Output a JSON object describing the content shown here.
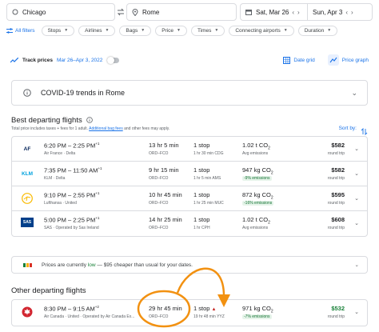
{
  "search": {
    "origin": "Chicago",
    "destination": "Rome",
    "depart_date": "Sat, Mar 26",
    "return_date": "Sun, Apr 3"
  },
  "filters": {
    "all_filters": "All filters",
    "chips": [
      "Stops",
      "Airlines",
      "Bags",
      "Price",
      "Times",
      "Connecting airports",
      "Duration"
    ]
  },
  "tracker": {
    "label": "Track prices",
    "range": "Mar 26–Apr 3, 2022",
    "date_grid": "Date grid",
    "price_graph": "Price graph"
  },
  "covid": {
    "label": "COVID-19 trends in Rome"
  },
  "best": {
    "title": "Best departing flights",
    "note_prefix": "Total price includes taxes + fees for 1 adult.",
    "note_link": "Additional bag fees",
    "note_suffix": "and other fees may apply.",
    "sort_label": "Sort by:",
    "flights": [
      {
        "logo": "AF",
        "logo_color": "#002157",
        "time": "6:20 PM – 2:25 PM",
        "plus": "+1",
        "airline": "Air France · Delta",
        "duration": "13 hr 5 min",
        "route": "ORD–FCO",
        "stops": "1 stop",
        "stop_detail": "1 hr 30 min CDG",
        "co2": "1.02 t CO",
        "co2_sub": "2",
        "emissions": "Avg emissions",
        "emissions_good": false,
        "price": "$582",
        "price_type": "round trip"
      },
      {
        "logo": "KLM",
        "logo_color": "#00a1de",
        "time": "7:35 PM – 11:50 AM",
        "plus": "+1",
        "airline": "KLM · Delta",
        "duration": "9 hr 15 min",
        "route": "ORD–FCO",
        "stops": "1 stop",
        "stop_detail": "1 hr 5 min AMS",
        "co2": "947 kg CO",
        "co2_sub": "2",
        "emissions": "-9% emissions",
        "emissions_good": true,
        "price": "$582",
        "price_type": "round trip"
      },
      {
        "logo": "LH",
        "logo_color": "#f9ba00",
        "time": "9:10 PM – 2:55 PM",
        "plus": "+1",
        "airline": "Lufthansa · United",
        "duration": "10 hr 45 min",
        "route": "ORD–FCO",
        "stops": "1 stop",
        "stop_detail": "1 hr 25 min MUC",
        "co2": "872 kg CO",
        "co2_sub": "2",
        "emissions": "-16% emissions",
        "emissions_good": true,
        "price": "$595",
        "price_type": "round trip"
      },
      {
        "logo": "SAS",
        "logo_color": "#003f8a",
        "time": "5:00 PM – 2:25 PM",
        "plus": "+1",
        "airline": "SAS · Operated by Sas Ireland",
        "duration": "14 hr 25 min",
        "route": "ORD–FCO",
        "stops": "1 stop",
        "stop_detail": "1 hr CPH",
        "co2": "1.02 t CO",
        "co2_sub": "2",
        "emissions": "Avg emissions",
        "emissions_good": false,
        "price": "$608",
        "price_type": "round trip"
      }
    ]
  },
  "low_price": {
    "prefix": "Prices are currently",
    "low": "low",
    "suffix": "— $95 cheaper than usual for your dates."
  },
  "other": {
    "title": "Other departing flights",
    "flights": [
      {
        "logo": "AC",
        "logo_color": "#d22630",
        "time": "8:30 PM – 9:15 AM",
        "plus": "+2",
        "airline": "Air Canada · United · Operated by Air Canada Ex...",
        "duration": "29 hr 45 min",
        "route": "ORD–FCO",
        "stops": "1 stop",
        "stop_detail": "19 hr 48 min YYZ",
        "co2": "971 kg CO",
        "co2_sub": "2",
        "emissions": "-7% emissions",
        "emissions_good": true,
        "price": "$532",
        "price_type": "round trip"
      }
    ]
  },
  "colors": {
    "accent": "#1a73e8",
    "annotation": "#f29111",
    "green": "#188038"
  }
}
